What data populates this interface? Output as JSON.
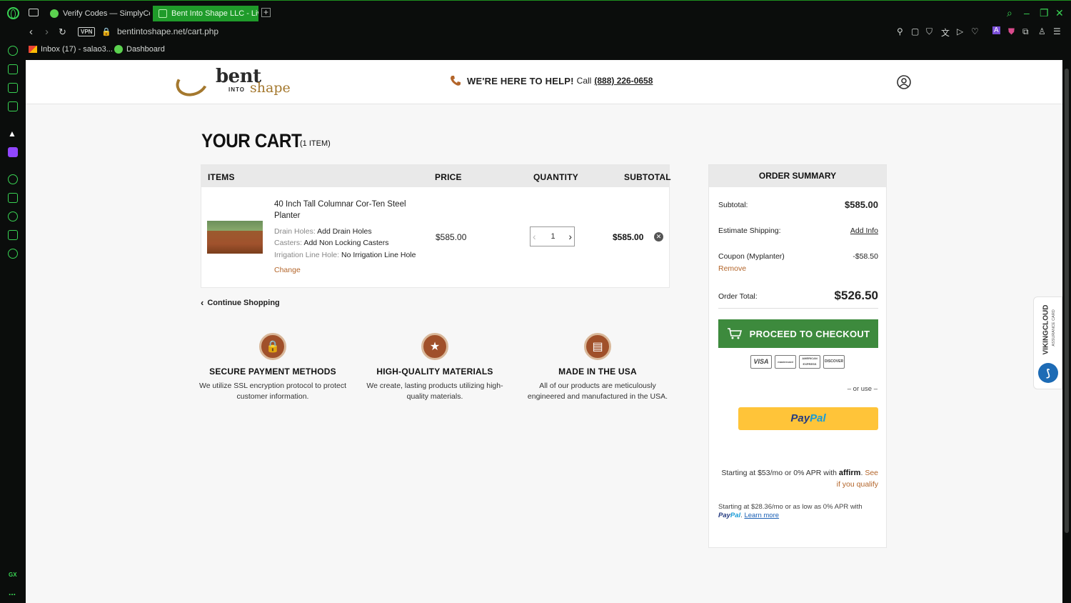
{
  "browser": {
    "tabs": [
      {
        "label": "Verify Codes — SimplyCod"
      },
      {
        "label": "Bent Into Shape LLC - Live"
      }
    ],
    "vpn_label": "VPN",
    "url": "bentintoshape.net/cart.php",
    "bookmarks": [
      {
        "label": "Inbox (17) - salao3..."
      },
      {
        "label": "Dashboard"
      }
    ],
    "sidebar_gx_label": "GX",
    "sidebar_more_label": "..."
  },
  "header": {
    "logo": {
      "bent": "bent",
      "into": "INTO",
      "shape": "shape"
    },
    "help_strong": "WE'RE HERE TO HELP!",
    "help_call": "Call",
    "help_phone": "(888) 226-0658"
  },
  "cart": {
    "title": "YOUR CART",
    "count": "(1 ITEM)",
    "columns": {
      "items": "ITEMS",
      "price": "PRICE",
      "quantity": "QUANTITY",
      "subtotal": "SUBTOTAL"
    },
    "item": {
      "name": "40 Inch Tall Columnar Cor-Ten Steel Planter",
      "options": [
        {
          "key": "Drain Holes:",
          "value": "Add Drain Holes"
        },
        {
          "key": "Casters:",
          "value": "Add Non Locking Casters"
        },
        {
          "key": "Irrigation Line Hole:",
          "value": "No Irrigation Line Hole"
        }
      ],
      "change_label": "Change",
      "price": "$585.00",
      "quantity": "1",
      "subtotal": "$585.00"
    },
    "continue_label": "Continue Shopping"
  },
  "features": [
    {
      "title": "SECURE PAYMENT METHODS",
      "text": "We utilize SSL encryption protocol to protect customer information."
    },
    {
      "title": "HIGH-QUALITY MATERIALS",
      "text": "We create, lasting products utilizing high-quality materials."
    },
    {
      "title": "MADE IN THE USA",
      "text": "All of our products are meticulously engineered and manufactured in the USA."
    }
  ],
  "summary": {
    "title": "ORDER SUMMARY",
    "subtotal_label": "Subtotal:",
    "subtotal_value": "$585.00",
    "shipping_label": "Estimate Shipping:",
    "shipping_link": "Add Info",
    "coupon_label": "Coupon (Myplanter)",
    "coupon_value": "-$58.50",
    "coupon_remove": "Remove",
    "total_label": "Order Total:",
    "total_value": "$526.50",
    "checkout_label": "PROCEED TO CHECKOUT",
    "cards": [
      "VISA",
      "mastercard",
      "AMERICAN EXPRESS",
      "DISCOVER"
    ],
    "or_use": "– or use –",
    "paypal_p1": "Pay",
    "paypal_p2": "Pal",
    "affirm_prefix": "Starting at $53/mo or 0% APR with",
    "affirm_brand": "affirm",
    "affirm_see": "See if you qualify",
    "pp_msg_prefix": "Starting at $28.36/mo or as low as 0% APR with",
    "pp_msg_learn": "Learn more"
  },
  "viking": {
    "title": "VIKINGCLOUD",
    "subtitle": "ASSURANCE CARD"
  },
  "colors": {
    "accent_green": "#3d8a3d",
    "link_orange": "#b3652a",
    "brand_brown": "#a4782e",
    "browser_green": "#39d353"
  }
}
